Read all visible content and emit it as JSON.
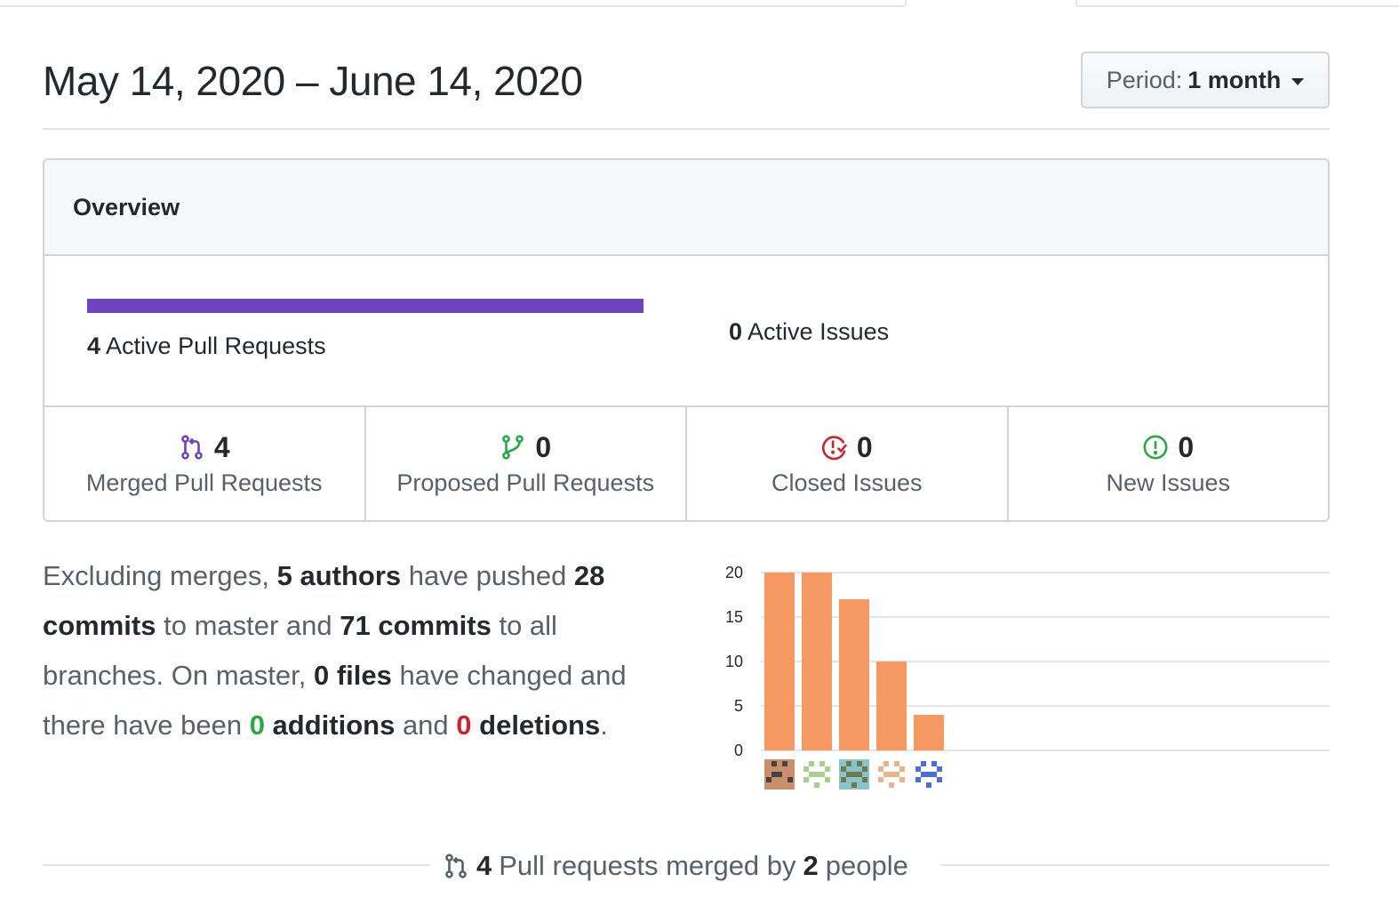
{
  "header": {
    "date_range": "May 14, 2020 – June 14, 2020",
    "period_label": "Period:",
    "period_value": "1 month"
  },
  "overview": {
    "title": "Overview",
    "active_prs_count": "4",
    "active_prs_label": "Active Pull Requests",
    "active_prs_fraction": 1.0,
    "active_issues_count": "0",
    "active_issues_label": "Active Issues",
    "stats": [
      {
        "icon": "git-merge-icon",
        "count": "4",
        "label": "Merged Pull Requests",
        "color": "#6f42c1"
      },
      {
        "icon": "git-pull-request-icon",
        "count": "0",
        "label": "Proposed Pull Requests",
        "color": "#28a745"
      },
      {
        "icon": "issue-closed-icon",
        "count": "0",
        "label": "Closed Issues",
        "color": "#cb2431"
      },
      {
        "icon": "issue-opened-icon",
        "count": "0",
        "label": "New Issues",
        "color": "#28a745"
      }
    ]
  },
  "summary": {
    "t1": "Excluding merges, ",
    "authors": "5 authors",
    "t2": " have pushed ",
    "commits_master": "28 commits",
    "t3": " to master and ",
    "commits_all": "71 commits",
    "t4": " to all branches. On master, ",
    "files": "0 files",
    "t5": " have changed and there have been ",
    "additions_num": "0",
    "additions_word": " additions",
    "t6": " and ",
    "deletions_num": "0",
    "deletions_word": " deletions",
    "t7": "."
  },
  "chart_data": {
    "type": "bar",
    "categories": [
      "author-1",
      "author-2",
      "author-3",
      "author-4",
      "author-5"
    ],
    "values": [
      20,
      20,
      17,
      10,
      4
    ],
    "ylim": [
      0,
      20
    ],
    "yticks": [
      "0",
      "5",
      "10",
      "15",
      "20"
    ],
    "bar_color": "#f59862",
    "grid": true
  },
  "footer": {
    "count": "4",
    "t1": " Pull requests merged by ",
    "people": "2",
    "t2": " people"
  },
  "colors": {
    "purple": "#6f42c1",
    "green": "#28a745",
    "red": "#cb2431"
  }
}
